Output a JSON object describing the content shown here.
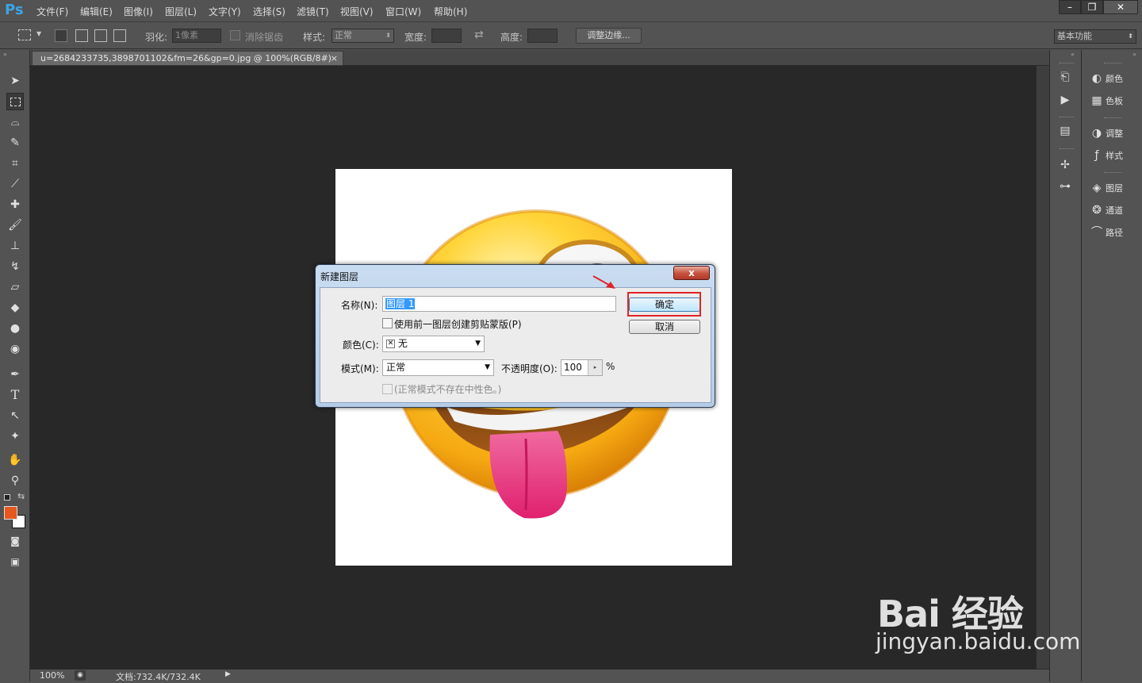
{
  "app": {
    "logo": "Ps",
    "menu": [
      "文件(F)",
      "编辑(E)",
      "图像(I)",
      "图层(L)",
      "文字(Y)",
      "选择(S)",
      "滤镜(T)",
      "视图(V)",
      "窗口(W)",
      "帮助(H)"
    ],
    "window_controls": [
      "–",
      "❐",
      "✕"
    ]
  },
  "options": {
    "feather_label": "羽化:",
    "feather_value": "1像素",
    "antialias_label": "消除锯齿",
    "style_label": "样式:",
    "style_value": "正常",
    "width_label": "宽度:",
    "height_label": "高度:",
    "refine_edge": "调整边缘...",
    "workspace": "基本功能"
  },
  "document": {
    "tab_title": "u=2684233735,3898701102&fm=26&gp=0.jpg @ 100%(RGB/8#)",
    "tab_close": "×"
  },
  "status": {
    "zoom": "100%",
    "doc_info": "文档:732.4K/732.4K"
  },
  "panels": {
    "narrow_icons": [
      "history-icon",
      "actions-icon",
      "properties-icon",
      "brush-presets-icon",
      "clone-source-icon"
    ],
    "items": [
      {
        "icon": "color-icon",
        "label": "颜色"
      },
      {
        "icon": "swatches-icon",
        "label": "色板"
      },
      {
        "icon": "adjustments-icon",
        "label": "调整"
      },
      {
        "icon": "styles-icon",
        "label": "样式"
      },
      {
        "icon": "layers-icon",
        "label": "图层"
      },
      {
        "icon": "channels-icon",
        "label": "通道"
      },
      {
        "icon": "paths-icon",
        "label": "路径"
      }
    ]
  },
  "dialog": {
    "title": "新建图层",
    "close": "x",
    "name_label": "名称(N):",
    "name_value": "图层 1",
    "clip_label": "使用前一图层创建剪贴蒙版(P)",
    "color_label": "颜色(C):",
    "color_value": "无",
    "mode_label": "模式(M):",
    "mode_value": "正常",
    "opacity_label": "不透明度(O):",
    "opacity_value": "100",
    "opacity_unit": "%",
    "neutral_label": "(正常模式不存在中性色。)",
    "ok": "确定",
    "cancel": "取消"
  },
  "watermark": {
    "brand": "Bai 经验",
    "url": "jingyan.baidu.com"
  },
  "colors": {
    "foreground": "#e8581c",
    "background": "#ffffff",
    "highlight": "#e0242a"
  }
}
